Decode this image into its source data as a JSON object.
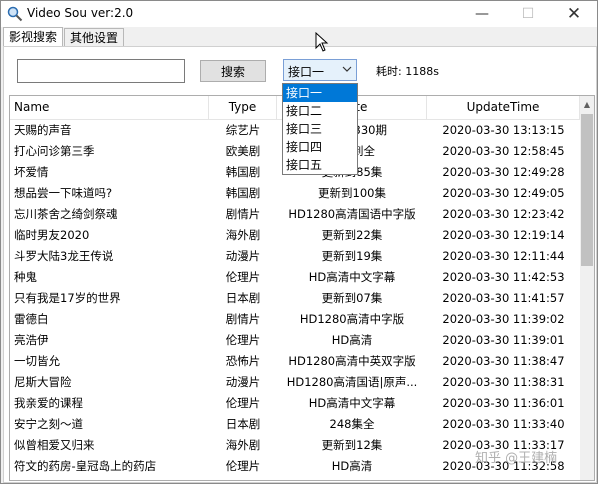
{
  "window": {
    "title": "Video Sou ver:2.0",
    "min_glyph": "—",
    "max_glyph": "☐",
    "close_glyph": "✕",
    "icon": "magnifier-icon"
  },
  "tabs": [
    {
      "label": "影视搜索",
      "active": true
    },
    {
      "label": "其他设置",
      "active": false
    }
  ],
  "search": {
    "value": "",
    "button_label": "搜索"
  },
  "interface_select": {
    "selected": "接口一",
    "options": [
      "接口一",
      "接口二",
      "接口三",
      "接口四",
      "接口五"
    ]
  },
  "elapsed": "耗时: 1188s",
  "table": {
    "columns": [
      "Name",
      "Type",
      "State",
      "UpdateTime"
    ],
    "rows": [
      [
        "天赐的声音",
        "综艺片",
        "20200330期",
        "2020-03-30 13:13:15"
      ],
      [
        "打心问诊第三季",
        "欧美剧",
        "更新到全",
        "2020-03-30 12:58:45"
      ],
      [
        "坏爱情",
        "韩国剧",
        "更新到85集",
        "2020-03-30 12:49:28"
      ],
      [
        "想品尝一下味道吗?",
        "韩国剧",
        "更新到100集",
        "2020-03-30 12:49:05"
      ],
      [
        "忘川茶舍之绮剑祭魂",
        "剧情片",
        "HD1280高清国语中字版",
        "2020-03-30 12:23:42"
      ],
      [
        "临时男友2020",
        "海外剧",
        "更新到22集",
        "2020-03-30 12:19:14"
      ],
      [
        "斗罗大陆3龙王传说",
        "动漫片",
        "更新到19集",
        "2020-03-30 12:11:44"
      ],
      [
        "种鬼",
        "伦理片",
        "HD高清中文字幕",
        "2020-03-30 11:42:53"
      ],
      [
        "只有我是17岁的世界",
        "日本剧",
        "更新到07集",
        "2020-03-30 11:41:57"
      ],
      [
        "雷德白",
        "剧情片",
        "HD1280高清中字版",
        "2020-03-30 11:39:02"
      ],
      [
        "亮浩伊",
        "伦理片",
        "HD高清",
        "2020-03-30 11:39:01"
      ],
      [
        "一切皆允",
        "恐怖片",
        "HD1280高清中英双字版",
        "2020-03-30 11:38:47"
      ],
      [
        "尼斯大冒险",
        "动漫片",
        "HD1280高清国语|原声...",
        "2020-03-30 11:38:31"
      ],
      [
        "我亲爱的课程",
        "伦理片",
        "HD高清中文字幕",
        "2020-03-30 11:36:01"
      ],
      [
        "安宁之刻～道",
        "日本剧",
        "248集全",
        "2020-03-30 11:33:40"
      ],
      [
        "似曾相爱又归来",
        "海外剧",
        "更新到12集",
        "2020-03-30 11:33:17"
      ],
      [
        "符文的药房-皇冠岛上的药店",
        "伦理片",
        "HD高清",
        "2020-03-30 11:32:58"
      ]
    ]
  },
  "watermark": "知乎 @王建楠"
}
